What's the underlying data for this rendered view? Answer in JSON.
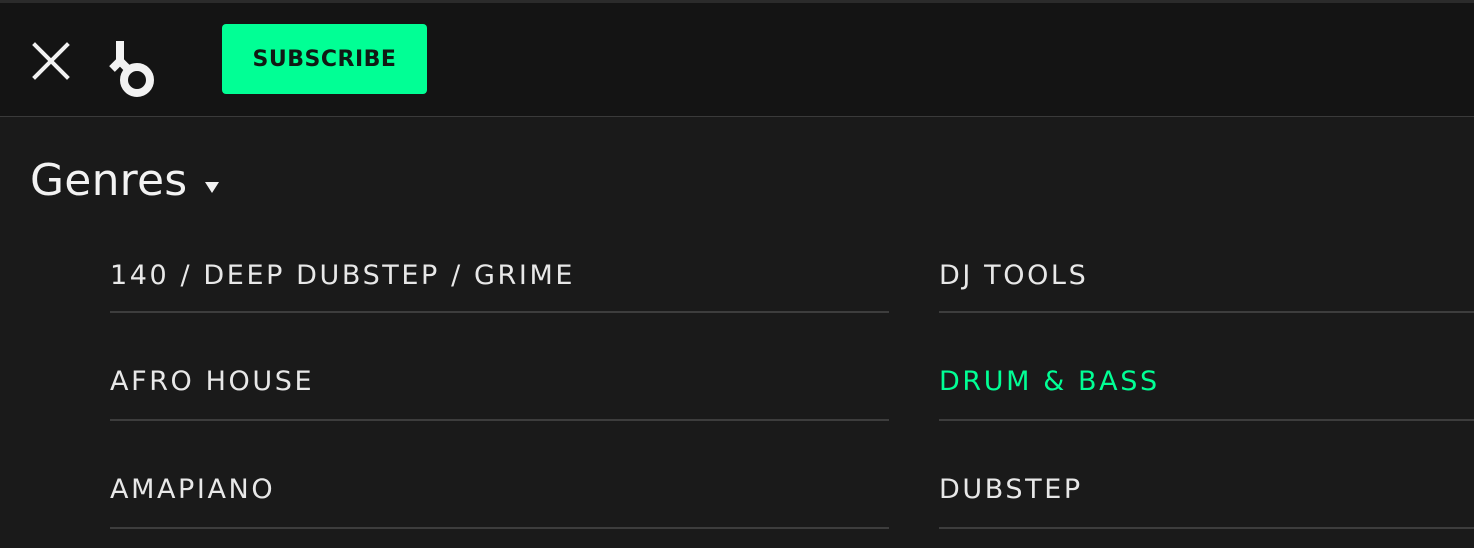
{
  "header": {
    "close_icon": "close-icon",
    "logo_icon": "beatport-logo-icon",
    "subscribe_label": "SUBSCRIBE",
    "accent_color": "#01ff95"
  },
  "genres": {
    "title": "Genres",
    "caret_icon": "caret-down-icon",
    "left_column": [
      {
        "label": "140 / DEEP DUBSTEP / GRIME",
        "active": false
      },
      {
        "label": "AFRO HOUSE",
        "active": false
      },
      {
        "label": "AMAPIANO",
        "active": false
      }
    ],
    "right_column": [
      {
        "label": "DJ TOOLS",
        "active": false
      },
      {
        "label": "DRUM & BASS",
        "active": true
      },
      {
        "label": "DUBSTEP",
        "active": false
      }
    ]
  }
}
